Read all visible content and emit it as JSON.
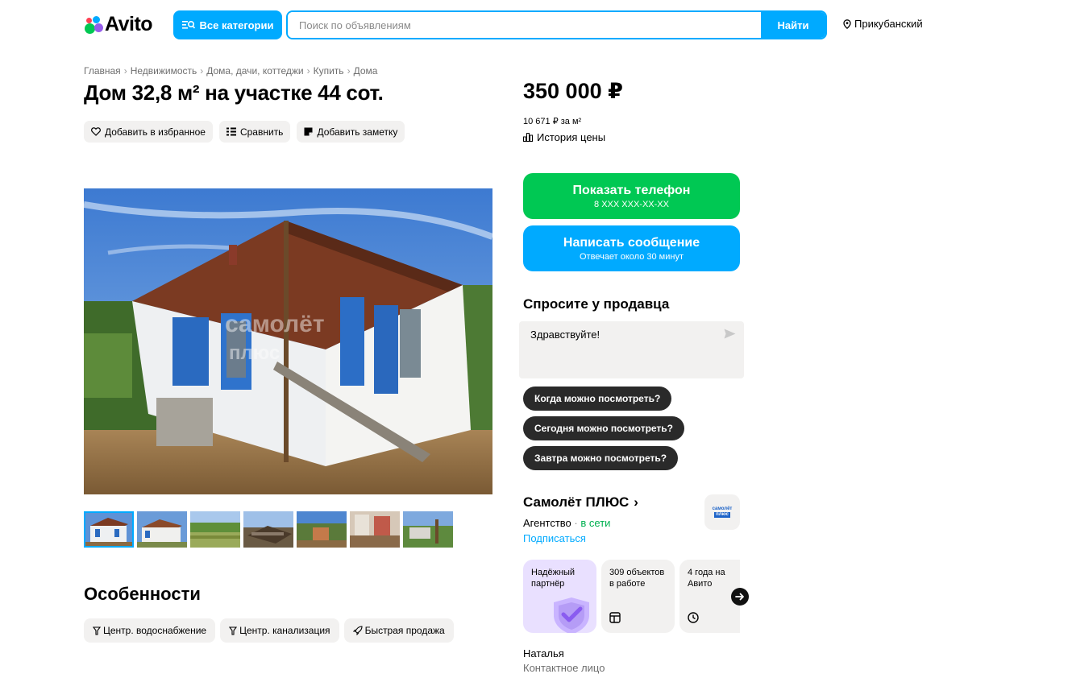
{
  "header": {
    "logo_text": "Avito",
    "categories_label": "Все категории",
    "search_placeholder": "Поиск по объявлениям",
    "search_button": "Найти",
    "location": "Прикубанский"
  },
  "breadcrumbs": [
    "Главная",
    "Недвижимость",
    "Дома, дачи, коттеджи",
    "Купить",
    "Дома"
  ],
  "title": "Дом 32,8 м² на участке 44 сот.",
  "actions": {
    "favorite": "Добавить в избранное",
    "compare": "Сравнить",
    "note": "Добавить заметку"
  },
  "gallery": {
    "watermark_line1": "самолёт",
    "watermark_line2": "плюс",
    "thumbnail_count": 7
  },
  "features": {
    "title": "Особенности",
    "items": [
      "Центр. водоснабжение",
      "Центр. канализация",
      "Быстрая продажа"
    ]
  },
  "price": {
    "value": "350 000 ₽",
    "per_m2": "10 671 ₽ за м²",
    "history_label": "История цены"
  },
  "contact_buttons": {
    "phone_label": "Показать телефон",
    "phone_mask": "8 XXX XXX-XX-XX",
    "message_label": "Написать сообщение",
    "message_sub": "Отвечает около 30 минут"
  },
  "ask": {
    "title": "Спросите у продавца",
    "message": "Здравствуйте!",
    "quick_questions": [
      "Когда можно посмотреть?",
      "Сегодня можно посмотреть?",
      "Завтра можно посмотреть?"
    ]
  },
  "seller": {
    "name": "Самолёт ПЛЮС",
    "type": "Агентство",
    "status": "в сети",
    "subscribe": "Подписаться",
    "logo_line1": "самолёт",
    "logo_line2": "плюс",
    "badges": [
      {
        "text": "Надёжный партнёр"
      },
      {
        "text": "309 объектов в работе"
      },
      {
        "text": "4 года на Авито"
      }
    ],
    "contact_name": "Наталья",
    "contact_role": "Контактное лицо"
  },
  "colors": {
    "brand_blue": "#00aaff",
    "phone_green": "#00c853",
    "pill_bg": "#f2f1f0",
    "dark_chip": "#2a2a2a"
  }
}
